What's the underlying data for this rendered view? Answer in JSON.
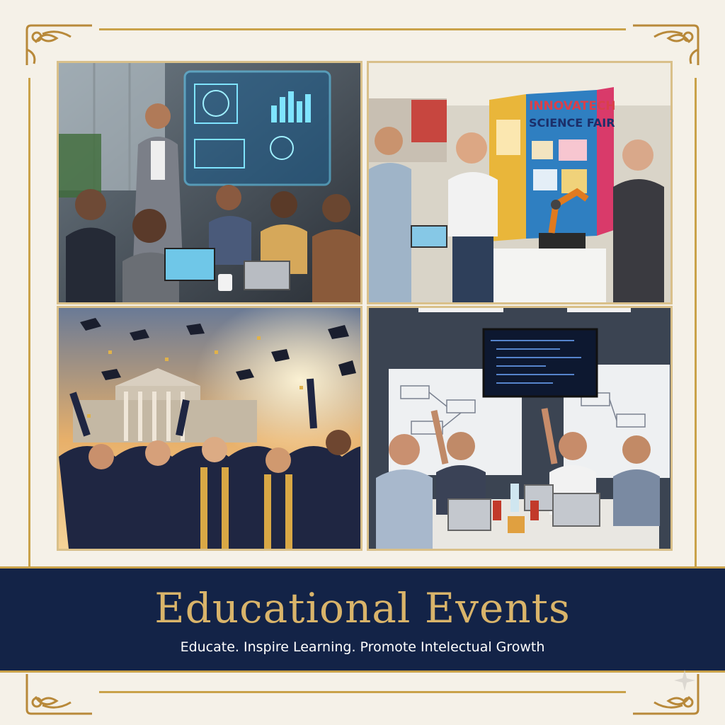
{
  "banner": {
    "title": "Educational Events",
    "subtitle": "Educate. Inspire Learning. Promote Intelectual Growth"
  },
  "panels": {
    "science_fair": {
      "sign_line1": "INNOVATECH",
      "sign_line2": "SCIENCE FAIR"
    }
  },
  "colors": {
    "navy": "#132347",
    "gold": "#c9a24a",
    "cream": "#f5f1e8"
  },
  "icons": [
    "corner-ornament-icon",
    "sparkle-watermark-icon"
  ]
}
